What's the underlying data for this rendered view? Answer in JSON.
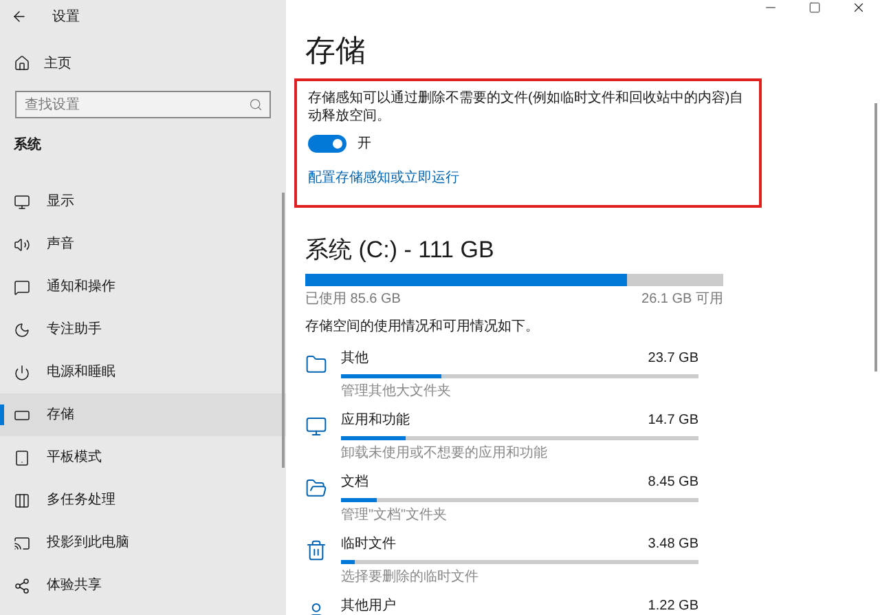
{
  "window": {
    "title": "设置"
  },
  "sidebar": {
    "home": "主页",
    "search": {
      "placeholder": "查找设置"
    },
    "section": "系统",
    "items": [
      {
        "label": "显示",
        "selected": false
      },
      {
        "label": "声音",
        "selected": false
      },
      {
        "label": "通知和操作",
        "selected": false
      },
      {
        "label": "专注助手",
        "selected": false
      },
      {
        "label": "电源和睡眠",
        "selected": false
      },
      {
        "label": "存储",
        "selected": true
      },
      {
        "label": "平板模式",
        "selected": false
      },
      {
        "label": "多任务处理",
        "selected": false
      },
      {
        "label": "投影到此电脑",
        "selected": false
      },
      {
        "label": "体验共享",
        "selected": false
      }
    ]
  },
  "page": {
    "title": "存储",
    "storage_sense": {
      "description": "存储感知可以通过删除不需要的文件(例如临时文件和回收站中的内容)自动释放空间。",
      "toggle": {
        "on": true,
        "label": "开"
      },
      "link": "配置存储感知或立即运行"
    },
    "drive": {
      "title": "系统 (C:) - 111 GB",
      "level": 0.77,
      "used": "已使用 85.6 GB",
      "free": "26.1 GB 可用",
      "caption": "存储空间的使用情况和可用情况如下。",
      "items": [
        {
          "name": "其他",
          "size": "23.7 GB",
          "level": 0.28,
          "description": "管理其他大文件夹"
        },
        {
          "name": "应用和功能",
          "size": "14.7 GB",
          "level": 0.18,
          "description": "卸载未使用或不想要的应用和功能"
        },
        {
          "name": "文档",
          "size": "8.45 GB",
          "level": 0.1,
          "description": "管理\"文档\"文件夹"
        },
        {
          "name": "临时文件",
          "size": "3.48 GB",
          "level": 0.04,
          "description": "选择要删除的临时文件"
        },
        {
          "name": "其他用户",
          "size": "1.22 GB"
        }
      ]
    }
  }
}
